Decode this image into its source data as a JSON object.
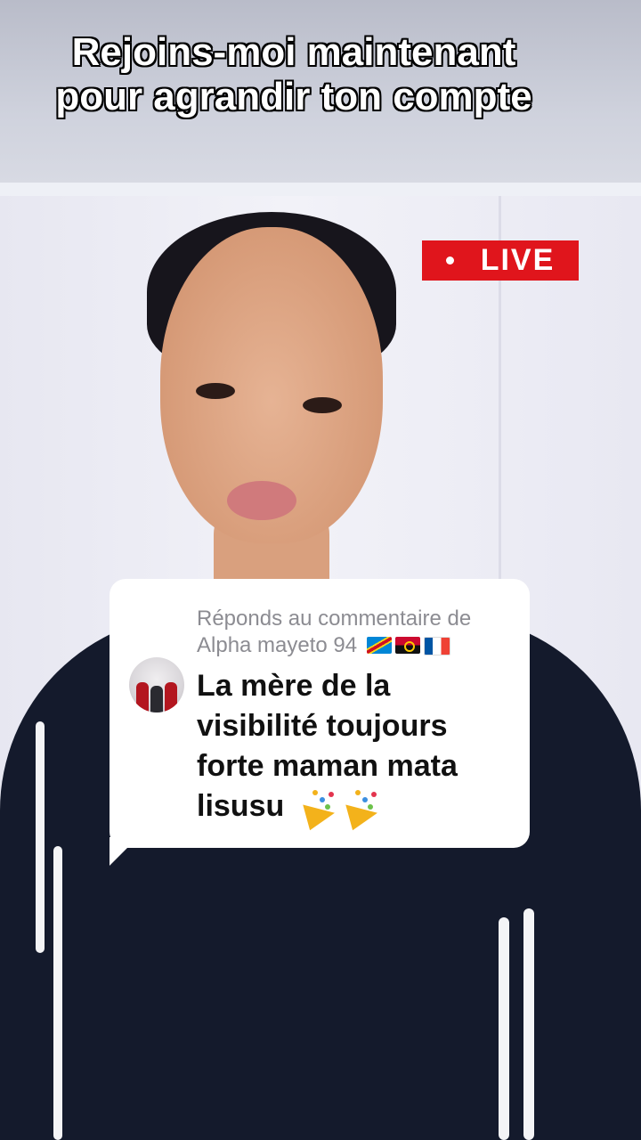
{
  "overlay": {
    "headline_line1": "Rejoins-moi maintenant",
    "headline_line2": "pour agrandir ton compte",
    "live_label": "LIVE"
  },
  "reply": {
    "header_prefix": "Réponds au commentaire de",
    "username": "Alpha mayeto 94",
    "username_flags": [
      "flag-congo-drc-icon",
      "flag-angola-icon",
      "flag-france-icon"
    ],
    "comment_text": "La mère de la visibilité toujours forte maman mata lisusu",
    "trailing_emoji": [
      "party-popper-icon",
      "party-popper-icon"
    ]
  },
  "colors": {
    "live_badge": "#e0151c",
    "card_background": "#ffffff",
    "header_text": "#8c8c92",
    "comment_text": "#111111"
  }
}
